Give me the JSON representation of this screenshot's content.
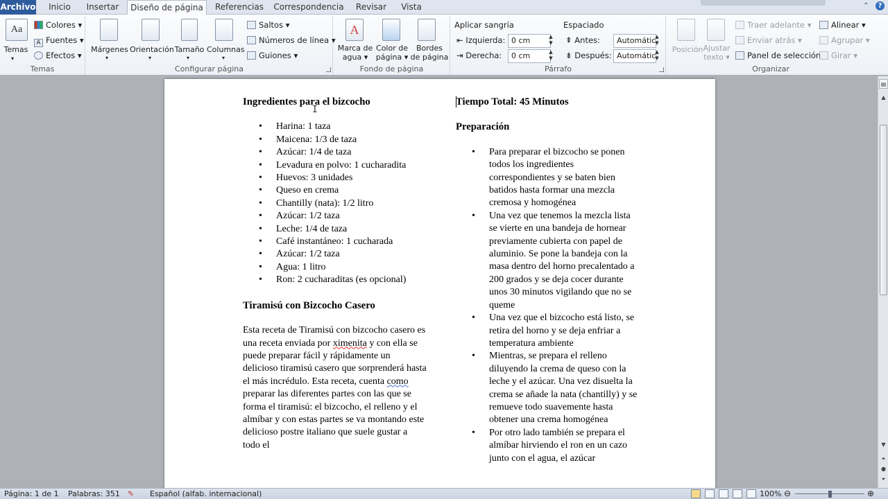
{
  "tabs": [
    "Archivo",
    "Inicio",
    "Insertar",
    "Diseño de página",
    "Referencias",
    "Correspondencia",
    "Revisar",
    "Vista"
  ],
  "temas": {
    "big": "Temas",
    "colores": "Colores",
    "fuentes": "Fuentes",
    "efectos": "Efectos",
    "group": "Temas"
  },
  "config": {
    "margenes": "Márgenes",
    "orientacion": "Orientación",
    "tamano": "Tamaño",
    "columnas": "Columnas",
    "saltos": "Saltos",
    "numeros": "Números de línea",
    "guiones": "Guiones",
    "group": "Configurar página"
  },
  "fondo": {
    "marca": [
      "Marca de",
      "agua"
    ],
    "color": [
      "Color de",
      "página"
    ],
    "bordes": [
      "Bordes",
      "de página"
    ],
    "group": "Fondo de página"
  },
  "parrafo": {
    "sangria": "Aplicar sangría",
    "izquierda": "Izquierda:",
    "izq_val": "0 cm",
    "derecha": "Derecha:",
    "der_val": "0 cm",
    "espaciado": "Espaciado",
    "antes": "Antes:",
    "antes_val": "Automátic",
    "despues": "Después:",
    "despues_val": "Automátic",
    "group": "Párrafo"
  },
  "organizar": {
    "posicion": "Posición",
    "ajustar": [
      "Ajustar",
      "texto"
    ],
    "traer": "Traer adelante",
    "enviar": "Enviar atrás",
    "panel": "Panel de selección",
    "alinear": "Alinear",
    "agrupar": "Agrupar",
    "girar": "Girar",
    "group": "Organizar"
  },
  "doc": {
    "left_heading": "Ingredientes para el bizcocho",
    "ingredients": [
      "Harina: 1 taza",
      "Maicena: 1/3 de taza",
      "Azúcar: 1/4 de taza",
      "Levadura en polvo: 1 cucharadita",
      "Huevos: 3 unidades",
      "Queso en crema",
      "Chantilly (nata): 1/2 litro",
      "Azúcar: 1/2 taza",
      "Leche: 1/4 de taza",
      "Café instantáneo: 1 cucharada",
      "Azúcar: 1/2 taza",
      "Agua: 1 litro",
      "Ron: 2 cucharaditas (es opcional)"
    ],
    "tiramisu_heading": "Tiramisú con Bizcocho Casero",
    "intro": {
      "p1": "Esta receta de Tiramisú  con bizcocho casero es una receta enviada por ",
      "name": "ximenita",
      "p2": " y con ella se puede preparar fácil y rápidamente un delicioso tiramisú casero que sorprenderá hasta el más incrédulo. Esta receta, cuenta ",
      "como": "como",
      "p3": " preparar las diferentes partes con las que se forma el tiramisú: el bizcocho, el relleno y el almíbar y con estas partes se va montando este delicioso postre italiano que suele gustar a todo el"
    },
    "time": "Tiempo Total: 45 Minutos",
    "prep_heading": "Preparación",
    "steps": [
      "Para preparar el bizcocho se ponen todos los ingredientes correspondientes y se baten bien batidos hasta formar una mezcla cremosa y homogénea",
      "Una vez que tenemos la mezcla lista se vierte en una bandeja de hornear previamente cubierta con papel de aluminio.  Se pone la bandeja con la masa dentro del horno precalentado a 200 grados y se deja cocer durante unos 30 minutos vigilando que no se queme",
      "Una vez que el bizcocho está listo, se retira del horno y se deja enfriar a temperatura ambiente",
      "Mientras, se prepara el relleno diluyendo la crema de queso con la leche y el azúcar. Una vez disuelta la crema se añade la nata (chantilly) y se remueve todo suavemente hasta obtener una crema homogénea",
      "Por otro lado también se prepara el almíbar hirviendo el ron en un cazo junto con el agua, el azúcar"
    ]
  },
  "status": {
    "pagina": "Página: 1 de 1",
    "palabras": "Palabras: 351",
    "idioma": "Español (alfab. internacional)",
    "zoom": "100%"
  }
}
